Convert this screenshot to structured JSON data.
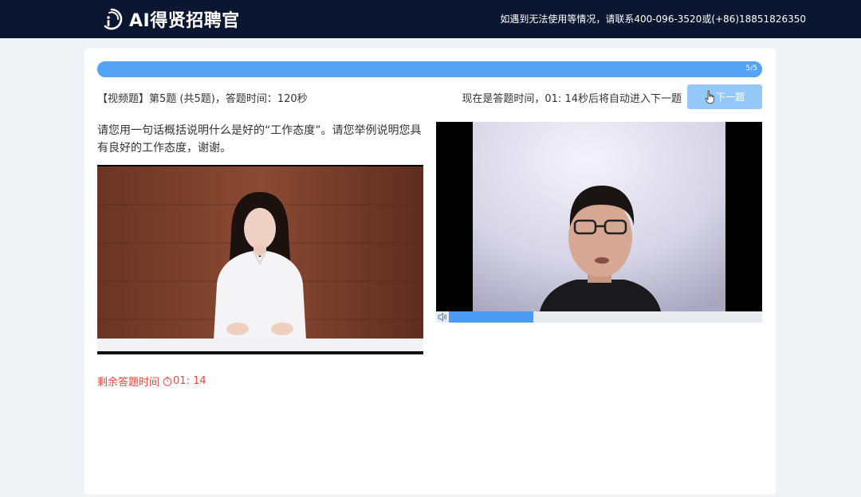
{
  "header": {
    "brand": "AI得贤招聘官",
    "contact": "如遇到无法使用等情况，请联系400-096-3520或(+86)18851826350"
  },
  "progress": {
    "label": "5/5",
    "fraction": 1.0
  },
  "question_meta": "【视频题】第5题 (共5题)，答题时间：120秒",
  "timer_message": "现在是答题时间，01: 14秒后将自动进入下一题",
  "next_button": "下一题",
  "question_text": "请您用一句话概括说明什么是好的“工作态度”。请您举例说明您具有良好的工作态度，谢谢。",
  "remaining": {
    "label": "剩余答题时间",
    "time": "01: 14"
  },
  "recording": {
    "played_fraction": 0.27
  },
  "colors": {
    "header_bg": "#0b1631",
    "accent": "#55a3f4",
    "button": "#94c8f8",
    "countdown": "#e8473b"
  },
  "icons": [
    "logo-icon",
    "pointer-hand-icon",
    "volume-icon",
    "clock-icon"
  ]
}
